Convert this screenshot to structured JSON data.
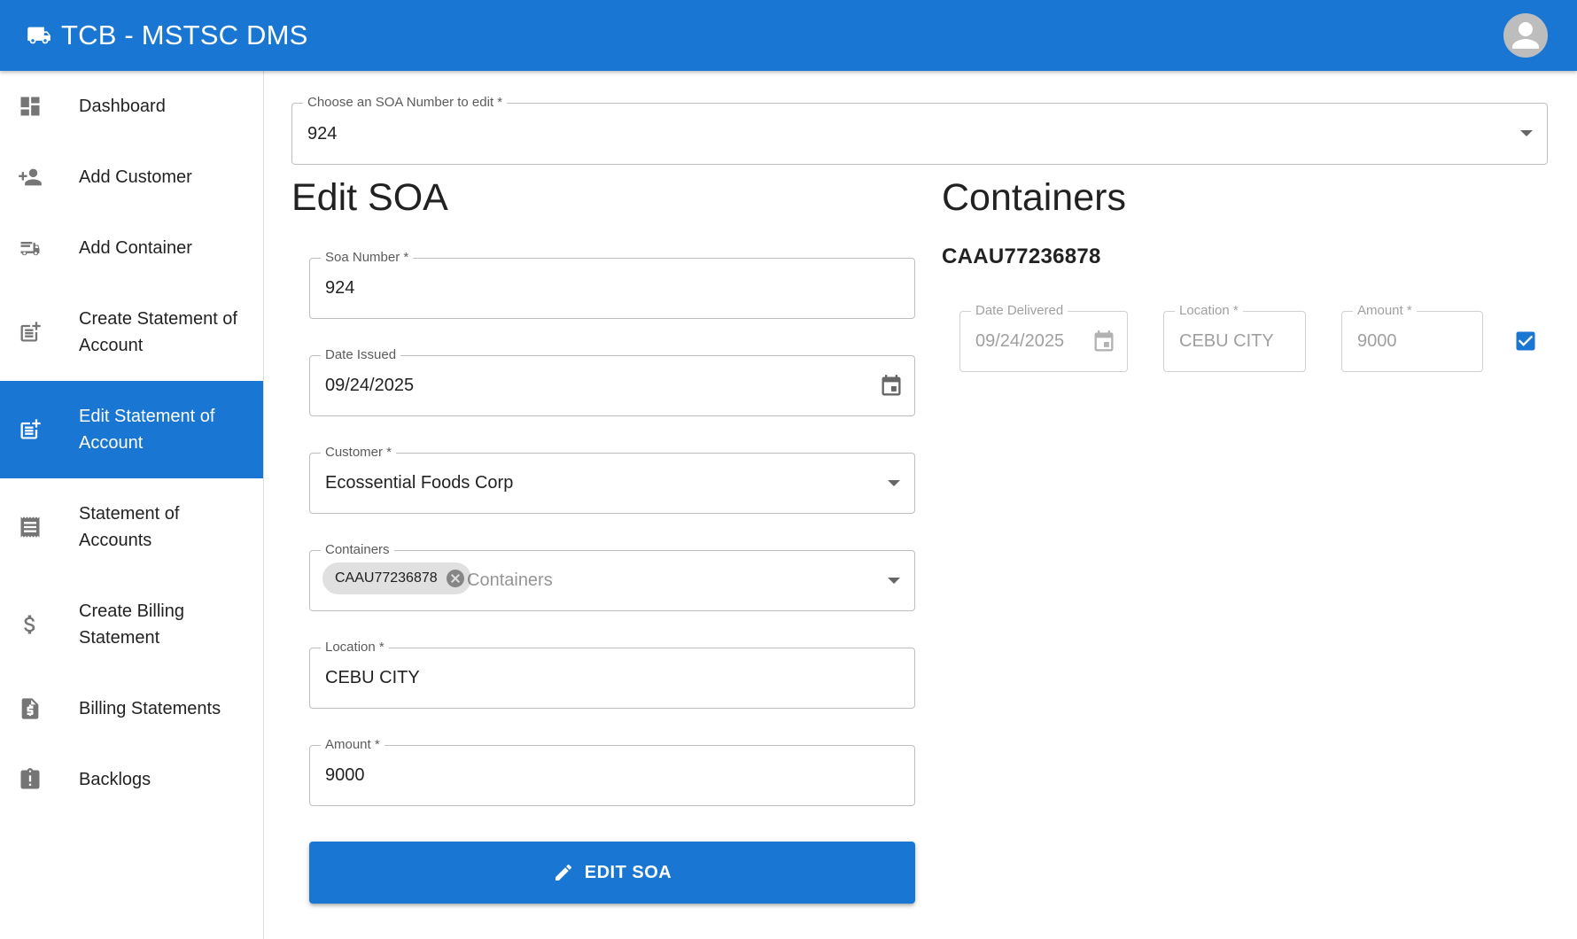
{
  "app": {
    "title": "TCB - MSTSC DMS",
    "brand_color": "#1976d2"
  },
  "sidebar": {
    "items": [
      {
        "label": "Dashboard",
        "icon": "dashboard-icon"
      },
      {
        "label": "Add Customer",
        "icon": "person-add-icon"
      },
      {
        "label": "Add Container",
        "icon": "rv-truck-icon"
      },
      {
        "label": "Create Statement of Account",
        "icon": "post-add-icon"
      },
      {
        "label": "Edit Statement of Account",
        "icon": "post-add-icon",
        "active": true
      },
      {
        "label": "Statement of Accounts",
        "icon": "receipt-icon"
      },
      {
        "label": "Create Billing Statement",
        "icon": "dollar-icon"
      },
      {
        "label": "Billing Statements",
        "icon": "request-quote-icon"
      },
      {
        "label": "Backlogs",
        "icon": "assignment-late-icon"
      }
    ]
  },
  "soa_select": {
    "label": "Choose an SOA Number to edit *",
    "value": "924"
  },
  "edit_form": {
    "heading": "Edit SOA",
    "soa_number": {
      "label": "Soa Number *",
      "value": "924"
    },
    "date_issued": {
      "label": "Date Issued",
      "value": "09/24/2025"
    },
    "customer": {
      "label": "Customer *",
      "value": "Ecossential Foods Corp"
    },
    "containers": {
      "label": "Containers",
      "chip": "CAAU77236878",
      "placeholder": "Containers"
    },
    "location": {
      "label": "Location *",
      "value": "CEBU CITY"
    },
    "amount": {
      "label": "Amount *",
      "value": "9000"
    },
    "submit_label": "EDIT SOA"
  },
  "containers_panel": {
    "heading": "Containers",
    "items": [
      {
        "id": "CAAU77236878",
        "date_delivered": {
          "label": "Date Delivered",
          "value": "09/24/2025"
        },
        "location": {
          "label": "Location *",
          "value": "CEBU CITY"
        },
        "amount": {
          "label": "Amount *",
          "value": "9000"
        },
        "checked": true
      }
    ]
  }
}
